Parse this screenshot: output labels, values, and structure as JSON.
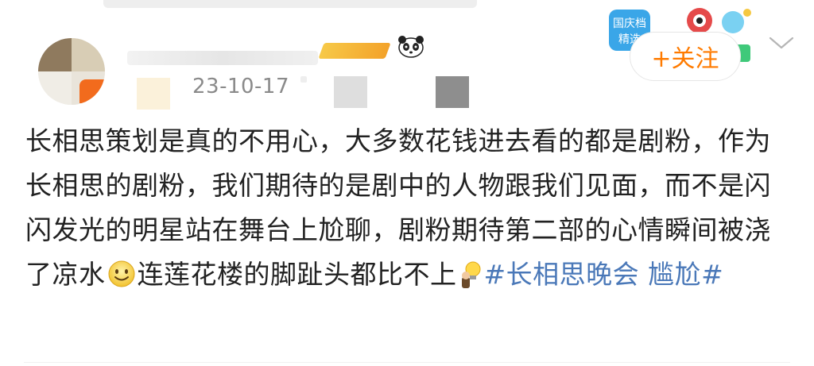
{
  "post": {
    "time": "23-10-17",
    "follow_label": "+关注",
    "content": {
      "text_part1": "长相思策划是真的不用心，大多数花钱进去看的都是剧粉，作为长相思的剧粉，我们期待的是剧中的人物跟我们见面，而不是闪闪发光的明星站在舞台上尬聊，剧粉期待第二部的心情瞬间被浇了凉水",
      "text_part2": "连莲花楼的脚趾头都比不上",
      "hashtag1": "#长相思晚会",
      "hashtag2": "尴尬#"
    },
    "badge": {
      "event_text_line1": "国庆档",
      "event_text_line2": "精选"
    }
  },
  "icons": {
    "panda": "panda-icon",
    "smile": "smile-emoji-icon",
    "bulb": "lightbulb-emoji-icon",
    "more": "chevron-down-icon"
  },
  "colors": {
    "follow_text": "#ff7b00",
    "hashtag": "#4a78b8",
    "text": "#222222",
    "time": "#8a8a8a"
  }
}
